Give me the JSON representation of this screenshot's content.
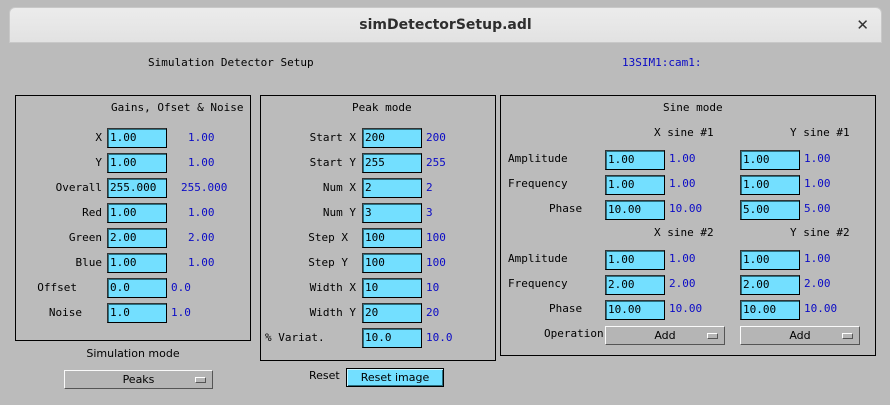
{
  "window": {
    "title": "simDetectorSetup.adl",
    "close_glyph": "✕"
  },
  "header": {
    "title": "Simulation Detector Setup",
    "pv": "13SIM1:cam1:"
  },
  "gains": {
    "title": "Gains, Ofset & Noise",
    "rows": [
      {
        "label": "X",
        "input": "1.00",
        "readback": "1.00"
      },
      {
        "label": "Y",
        "input": "1.00",
        "readback": "1.00"
      },
      {
        "label": "Overall",
        "input": "255.000",
        "readback": "255.000"
      },
      {
        "label": "Red",
        "input": "1.00",
        "readback": "1.00"
      },
      {
        "label": "Green",
        "input": "2.00",
        "readback": "2.00"
      },
      {
        "label": "Blue",
        "input": "1.00",
        "readback": "1.00"
      },
      {
        "label": "Offset",
        "input": "0.0",
        "readback": "0.0"
      },
      {
        "label": "Noise",
        "input": "1.0",
        "readback": "1.0"
      }
    ]
  },
  "simmode": {
    "label": "Simulation mode",
    "value": "Peaks"
  },
  "peak": {
    "title": "Peak mode",
    "rows": [
      {
        "label": "Start X",
        "input": "200",
        "readback": "200"
      },
      {
        "label": "Start Y",
        "input": "255",
        "readback": "255"
      },
      {
        "label": "Num X",
        "input": "2",
        "readback": "2"
      },
      {
        "label": "Num Y",
        "input": "3",
        "readback": "3"
      },
      {
        "label": "Step X",
        "input": "100",
        "readback": "100"
      },
      {
        "label": "Step Y",
        "input": "100",
        "readback": "100"
      },
      {
        "label": "Width X",
        "input": "10",
        "readback": "10"
      },
      {
        "label": "Width Y",
        "input": "20",
        "readback": "20"
      },
      {
        "label": "% Variat.",
        "input": "10.0",
        "readback": "10.0"
      }
    ]
  },
  "reset": {
    "label": "Reset",
    "button": "Reset image"
  },
  "sine": {
    "title": "Sine mode",
    "x1_header": "X sine #1",
    "y1_header": "Y sine #1",
    "x2_header": "X sine #2",
    "y2_header": "Y sine #2",
    "row_labels": [
      "Amplitude",
      "Frequency",
      "Phase"
    ],
    "group1": {
      "x": [
        {
          "input": "1.00",
          "readback": "1.00"
        },
        {
          "input": "1.00",
          "readback": "1.00"
        },
        {
          "input": "10.00",
          "readback": "10.00"
        }
      ],
      "y": [
        {
          "input": "1.00",
          "readback": "1.00"
        },
        {
          "input": "1.00",
          "readback": "1.00"
        },
        {
          "input": "5.00",
          "readback": "5.00"
        }
      ]
    },
    "group2": {
      "x": [
        {
          "input": "1.00",
          "readback": "1.00"
        },
        {
          "input": "2.00",
          "readback": "2.00"
        },
        {
          "input": "10.00",
          "readback": "10.00"
        }
      ],
      "y": [
        {
          "input": "1.00",
          "readback": "1.00"
        },
        {
          "input": "2.00",
          "readback": "2.00"
        },
        {
          "input": "10.00",
          "readback": "10.00"
        }
      ]
    },
    "operation_label": "Operation",
    "x_operation": "Add",
    "y_operation": "Add"
  }
}
